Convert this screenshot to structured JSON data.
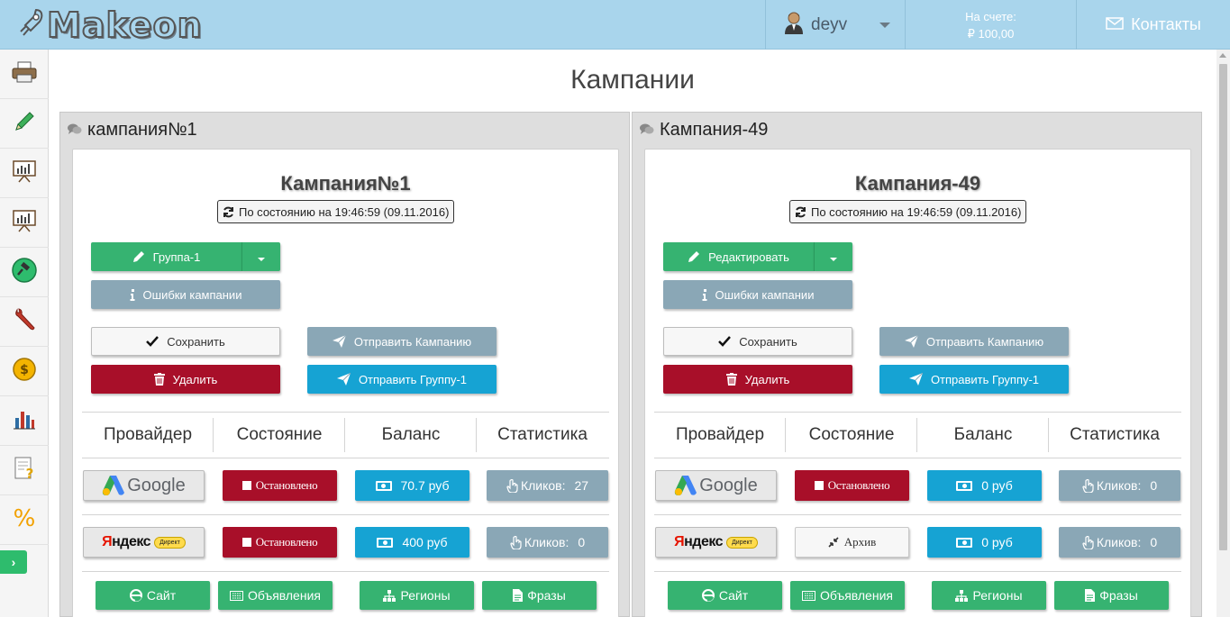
{
  "header": {
    "logo_text": "Makeon",
    "username": "deyv",
    "balance_label": "На счете:",
    "balance_value": "₽ 100,00",
    "contacts_label": "Контакты"
  },
  "sidebar": {
    "items": [
      {
        "icon": "printer-icon"
      },
      {
        "icon": "pencil-icon"
      },
      {
        "icon": "presentation-chart-icon"
      },
      {
        "icon": "presentation-chart-icon"
      },
      {
        "icon": "auction-hammer-icon"
      },
      {
        "icon": "wrench-icon"
      },
      {
        "icon": "dollar-coin-icon"
      },
      {
        "icon": "bar-chart-icon"
      },
      {
        "icon": "document-question-icon"
      },
      {
        "icon": "percent-icon"
      }
    ],
    "expand_label": "›"
  },
  "page_title": "Кампании",
  "campaigns": [
    {
      "panel_title": "кампания№1",
      "title": "Кампания№1",
      "status": "По состоянию на 19:46:59 (09.11.2016)",
      "primary_button": "Группа-1",
      "errors_button": "Ошибки кампании",
      "save_button": "Сохранить",
      "delete_button": "Удалить",
      "send_campaign_button": "Отправить Кампанию",
      "send_group_button": "Отправить Группу-1",
      "columns": [
        "Провайдер",
        "Состояние",
        "Баланс",
        "Статистика"
      ],
      "rows": [
        {
          "provider": "Google",
          "state": "Остановлено",
          "state_style": "red",
          "balance": "70.7 руб",
          "clicks_label": "Кликов:",
          "clicks": "27"
        },
        {
          "provider": "Яндекс Директ",
          "state": "Остановлено",
          "state_style": "red",
          "balance": "400 руб",
          "clicks_label": "Кликов:",
          "clicks": "0"
        }
      ],
      "bottom_buttons": [
        "Сайт",
        "Объявления",
        "Регионы",
        "Фразы"
      ]
    },
    {
      "panel_title": "Кампания-49",
      "title": "Кампания-49",
      "status": "По состоянию на 19:46:59 (09.11.2016)",
      "primary_button": "Редактировать",
      "errors_button": "Ошибки кампании",
      "save_button": "Сохранить",
      "delete_button": "Удалить",
      "send_campaign_button": "Отправить Кампанию",
      "send_group_button": "Отправить Группу-1",
      "columns": [
        "Провайдер",
        "Состояние",
        "Баланс",
        "Статистика"
      ],
      "rows": [
        {
          "provider": "Google",
          "state": "Остановлено",
          "state_style": "red",
          "balance": "0 руб",
          "clicks_label": "Кликов:",
          "clicks": "0"
        },
        {
          "provider": "Яндекс Директ",
          "state": "Архив",
          "state_style": "white",
          "balance": "0 руб",
          "clicks_label": "Кликов:",
          "clicks": "0"
        }
      ],
      "bottom_buttons": [
        "Сайт",
        "Объявления",
        "Регионы",
        "Фразы"
      ]
    }
  ],
  "colors": {
    "header_bg": "#a9d5ec",
    "green": "#36b371",
    "red": "#a80f29",
    "cyan": "#16a3d3",
    "grey_blue": "#8aa7b6"
  }
}
